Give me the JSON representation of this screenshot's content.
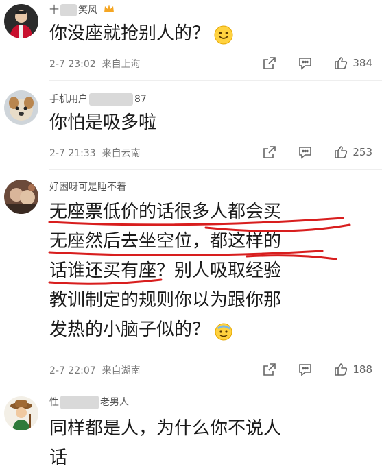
{
  "comments": [
    {
      "username_prefix": "十",
      "username_suffix": "笑风",
      "text": "你没座就抢别人的？",
      "time": "2-7 23:02",
      "location": "来自上海",
      "likes": "384",
      "emoji": "smile-emoji"
    },
    {
      "username_prefix": "手机用户",
      "username_suffix": "87",
      "text": "你怕是吸多啦",
      "time": "2-7 21:33",
      "location": "来自云南",
      "likes": "253"
    },
    {
      "username_prefix": "好困呀可是睡不着",
      "lines": [
        "无座票低价的话很多人都会买",
        "无座然后去坐空位，都这样的",
        "话谁还买有座？别人吸取经验",
        "教训制定的规则你以为跟你那",
        "发热的小脑子似的？"
      ],
      "time": "2-7 22:07",
      "location": "来自湖南",
      "likes": "188",
      "emoji": "sweat-emoji"
    },
    {
      "username_prefix": "性",
      "username_suffix": "老男人",
      "lines": [
        "同样都是人，为什么你不说人",
        "话"
      ]
    }
  ],
  "colors": {
    "highlight_red": "#d81e1e",
    "meta_gray": "#7a7a7a",
    "badge_orange": "#f5a623"
  }
}
